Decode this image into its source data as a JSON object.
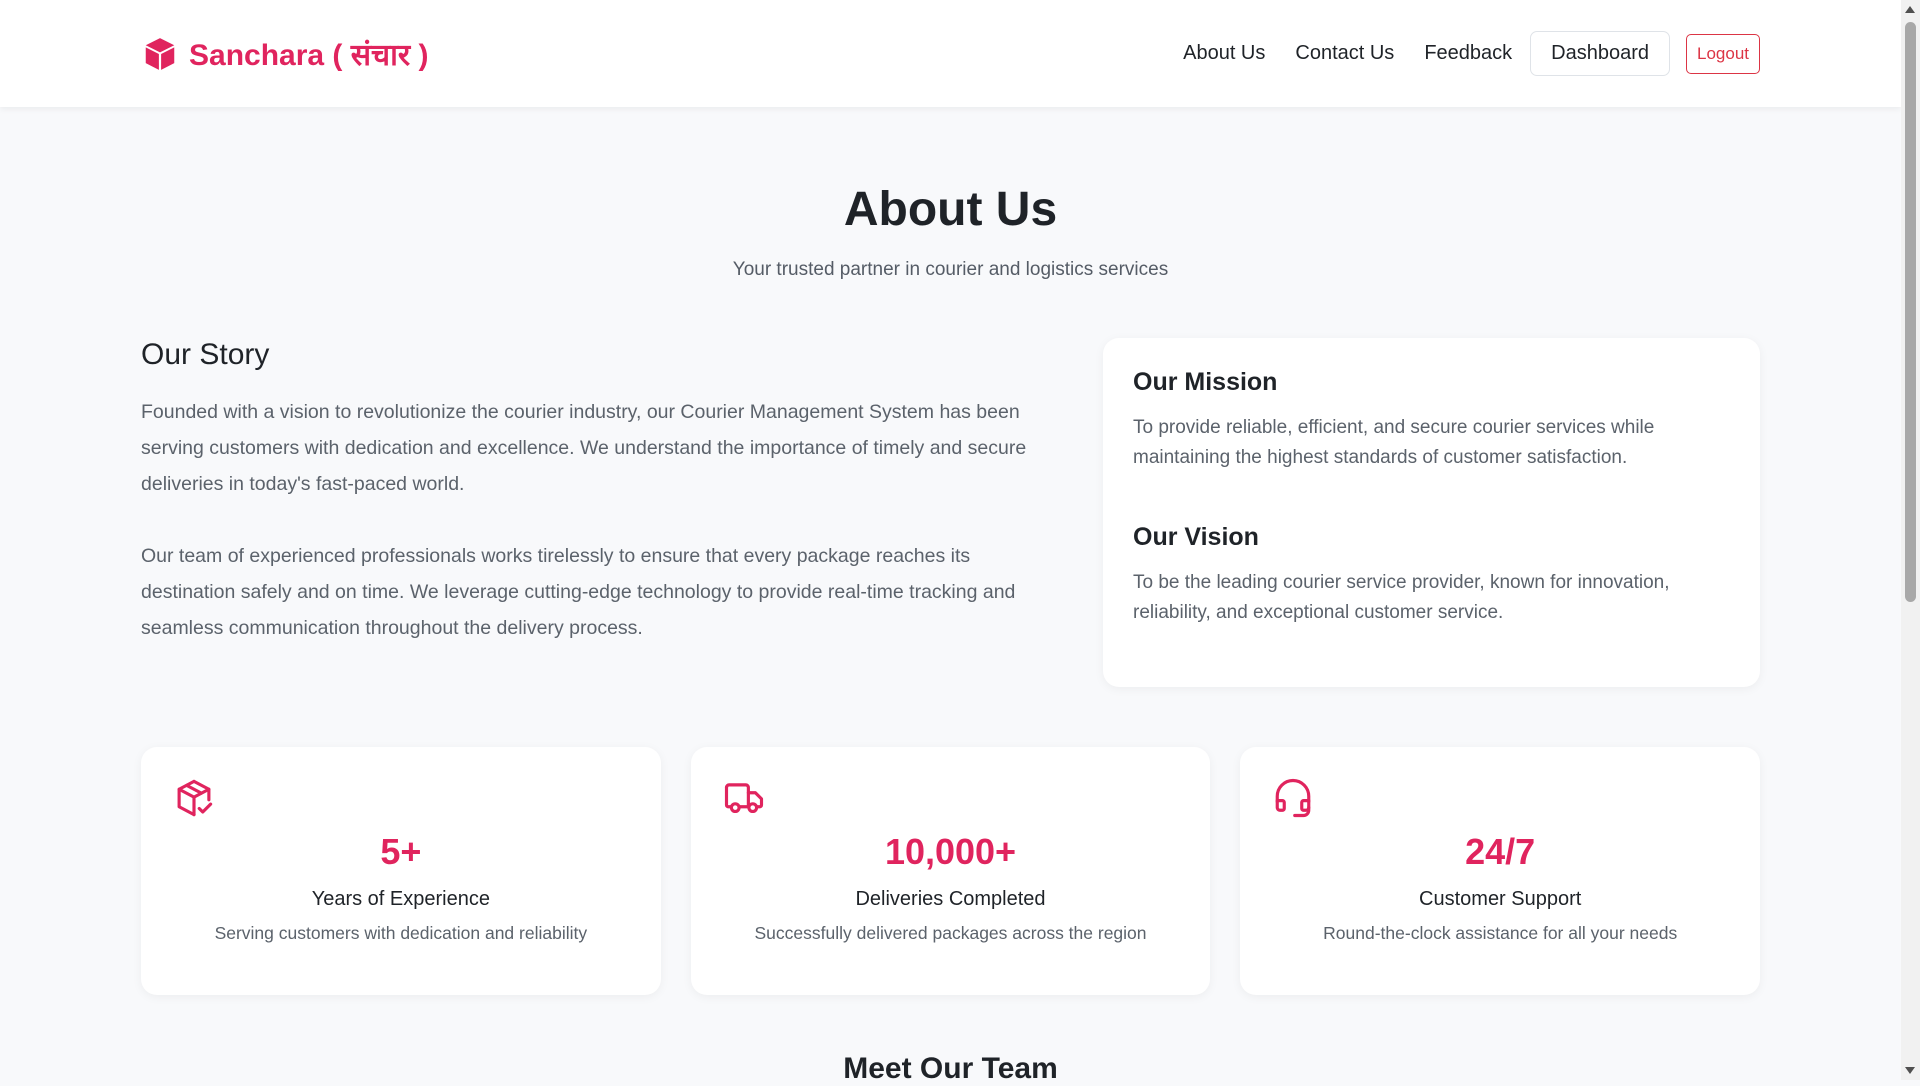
{
  "brand": {
    "name": "Sanchara ( संचार )",
    "icon": "package-icon",
    "color": "#e0245e"
  },
  "nav": {
    "about": "About Us",
    "contact": "Contact Us",
    "feedback": "Feedback",
    "dashboard": "Dashboard",
    "logout": "Logout"
  },
  "hero": {
    "title": "About Us",
    "subtitle": "Your trusted partner in courier and logistics services"
  },
  "story": {
    "title": "Our Story",
    "p1": "Founded with a vision to revolutionize the courier industry, our Courier Management System has been serving customers with dedication and excellence. We understand the importance of timely and secure deliveries in today's fast-paced world.",
    "p2": "Our team of experienced professionals works tirelessly to ensure that every package reaches its destination safely and on time. We leverage cutting-edge technology to provide real-time tracking and seamless communication throughout the delivery process."
  },
  "mission": {
    "title": "Our Mission",
    "text": "To provide reliable, efficient, and secure courier services while maintaining the highest standards of customer satisfaction."
  },
  "vision": {
    "title": "Our Vision",
    "text": "To be the leading courier service provider, known for innovation, reliability, and exceptional customer service."
  },
  "stats": [
    {
      "icon": "package-check-icon",
      "value": "5+",
      "label": "Years of Experience",
      "desc": "Serving customers with dedication and reliability"
    },
    {
      "icon": "truck-icon",
      "value": "10,000+",
      "label": "Deliveries Completed",
      "desc": "Successfully delivered packages across the region"
    },
    {
      "icon": "headset-icon",
      "value": "24/7",
      "label": "Customer Support",
      "desc": "Round-the-clock assistance for all your needs"
    }
  ],
  "team": {
    "title": "Meet Our Team"
  },
  "colors": {
    "accent": "#e0245e",
    "danger": "#dc3545",
    "background": "#f8f9fb"
  }
}
